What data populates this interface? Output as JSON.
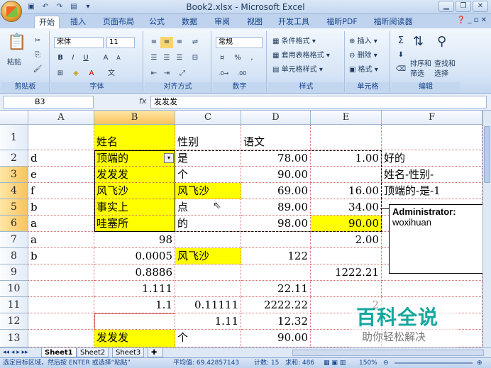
{
  "window": {
    "title": "Book2.xlsx - Microsoft Excel"
  },
  "tabs": [
    "开始",
    "插入",
    "页面布局",
    "公式",
    "数据",
    "审阅",
    "视图",
    "开发工具",
    "福昕PDF",
    "福昕阅读器"
  ],
  "ribbon": {
    "clipboard": {
      "label": "剪贴板",
      "paste": "粘贴"
    },
    "font": {
      "label": "字体",
      "name": "宋体",
      "size": "11",
      "bold": "B",
      "italic": "I",
      "underline": "U",
      "grow": "A",
      "shrink": "A",
      "wen": "文"
    },
    "alignment": {
      "label": "对齐方式"
    },
    "number": {
      "label": "数字",
      "format": "常规",
      "percent": "%",
      "comma": ","
    },
    "styles": {
      "label": "样式",
      "conditional": "条件格式",
      "table": "套用表格格式",
      "cell": "单元格样式"
    },
    "cells": {
      "label": "单元格",
      "insert": "插入",
      "delete": "删除",
      "format": "格式"
    },
    "editing": {
      "label": "编辑",
      "sort": "排序和",
      "filter": "筛选",
      "find": "查找和",
      "select": "选择"
    }
  },
  "formula_bar": {
    "name_box": "B3",
    "fx": "fx",
    "content": "发发发"
  },
  "columns": [
    "A",
    "B",
    "C",
    "D",
    "E",
    "F"
  ],
  "rows": [
    "1",
    "2",
    "3",
    "4",
    "5",
    "6",
    "7",
    "8",
    "9",
    "10",
    "11",
    "12",
    "13"
  ],
  "cells": {
    "r1": {
      "b": "姓名",
      "c": "性别",
      "d": "语文"
    },
    "r2": {
      "a": "d",
      "b": "顶端的",
      "c": "是",
      "d": "78.00",
      "e": "1.00",
      "f": "好的"
    },
    "r3": {
      "a": "e",
      "b": "发发发",
      "c": "个",
      "d": "90.00",
      "f": "姓名-性别-"
    },
    "r4": {
      "a": "f",
      "b": "风飞沙",
      "c": "风飞沙",
      "d": "69.00",
      "e": "16.00",
      "f": "顶端的-是-1"
    },
    "r5": {
      "a": "b",
      "b": "事实上",
      "c": "点",
      "d": "89.00",
      "e": "34.00"
    },
    "r6": {
      "a": "a",
      "b": "哇塞所",
      "c": "的",
      "d": "98.00",
      "e": "90.00"
    },
    "r7": {
      "a": "a",
      "b": "98",
      "e": "2.00"
    },
    "r8": {
      "a": "b",
      "b": "0.0005",
      "c": "风飞沙",
      "d": "122"
    },
    "r9": {
      "b": "0.8886",
      "e": "1222.21"
    },
    "r10": {
      "b": "1.111",
      "d": "22.11"
    },
    "r11": {
      "b": "1.1",
      "c": "0.11111",
      "d": "2222.22",
      "e": "2"
    },
    "r12": {
      "c": "1.11",
      "d": "12.32"
    },
    "r13": {
      "b": "发发发",
      "c": "个",
      "d": "90.00"
    }
  },
  "comment": {
    "author": "Administrator:",
    "text": "woxihuan"
  },
  "sheets": [
    "Sheet1",
    "Sheet2",
    "Sheet3"
  ],
  "status": {
    "message": "选定目标区域，然后按 ENTER 或选择“粘贴”",
    "average": "平均值: 69.42857143",
    "count": "计数: 15",
    "sum": "求和: 486",
    "zoom": "150%"
  },
  "watermark": {
    "title": "百科全说",
    "subtitle": "助你轻松解决"
  },
  "colors": {
    "highlight": "#ffff00",
    "accent": "#15428b",
    "watermark": "#13a89e"
  }
}
